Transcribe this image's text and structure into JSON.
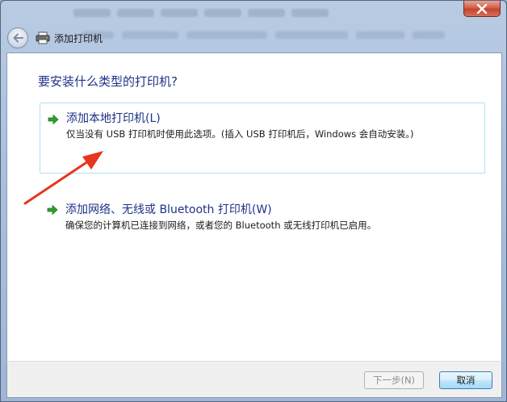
{
  "window": {
    "title": "添加打印机",
    "close_label": "✕"
  },
  "main": {
    "heading": "要安装什么类型的打印机?",
    "options": [
      {
        "title": "添加本地打印机(L)",
        "description": "仅当没有 USB 打印机时使用此选项。(插入 USB 打印机后，Windows 会自动安装。)"
      },
      {
        "title": "添加网络、无线或 Bluetooth 打印机(W)",
        "description": "确保您的计算机已连接到网络，或者您的 Bluetooth 或无线打印机已启用。"
      }
    ]
  },
  "footer": {
    "next_label": "下一步(N)",
    "cancel_label": "取消"
  },
  "colors": {
    "heading": "#1e3287",
    "arrow_green": "#2e9e2e",
    "annotation_red": "#e8351f",
    "selection_border": "#aee0ef"
  }
}
